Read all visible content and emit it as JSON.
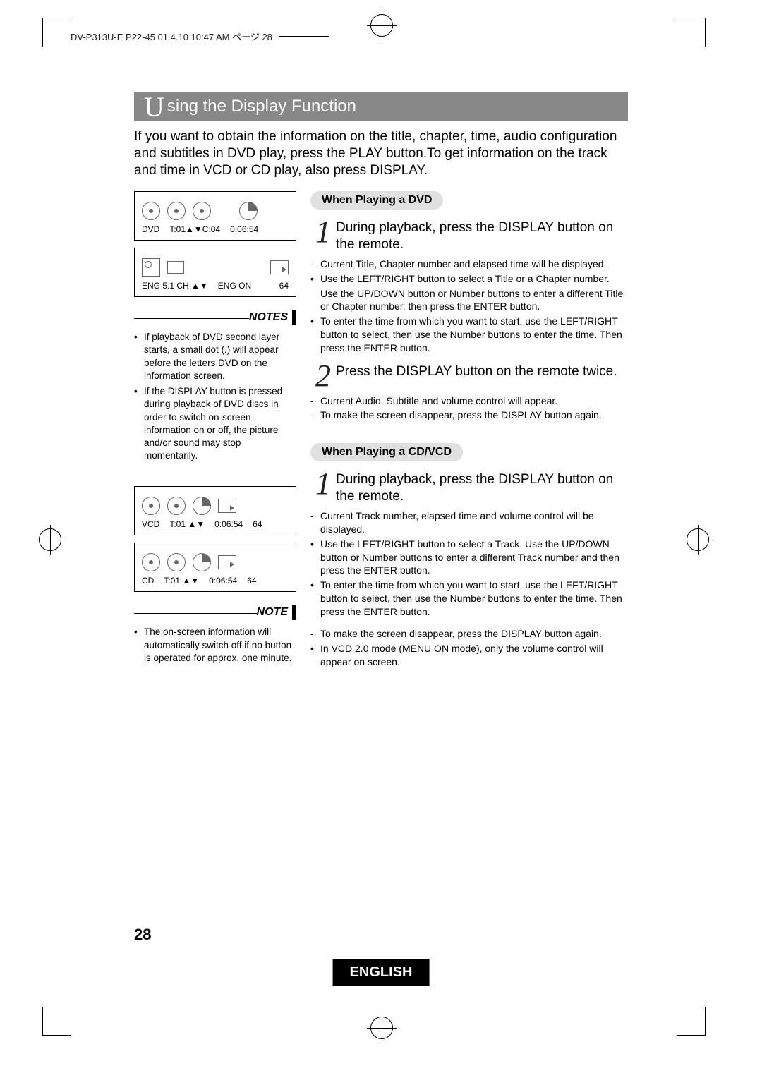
{
  "header": "DV-P313U-E  P22-45  01.4.10 10:47 AM  ページ 28",
  "title_cap": "U",
  "title_rest": "sing the Display Function",
  "intro": "If you want to obtain the information on the title, chapter, time, audio configuration and subtitles in DVD play, press the PLAY button.To get information on the track and time in VCD or CD play, also press DISPLAY.",
  "osd1": {
    "l1": "DVD",
    "l2": "T:01▲▼C:04",
    "l3": "0:06:54",
    "b1": "ENG 5.1 CH ▲▼",
    "b2": "ENG ON",
    "b3": "64"
  },
  "notes1_label": "NOTES",
  "notes1": [
    "If playback of DVD second layer starts, a small dot (.) will appear before the letters DVD on the information screen.",
    "If the DISPLAY button is pressed during playback of DVD discs in order to switch on-screen information on or off, the picture and/or sound may stop momentarily."
  ],
  "osd2": {
    "l1": "VCD",
    "l2": "T:01 ▲▼",
    "l3": "0:06:54",
    "l4": "64"
  },
  "osd3": {
    "l1": "CD",
    "l2": "T:01 ▲▼",
    "l3": "0:06:54",
    "l4": "64"
  },
  "notes2_label": "NOTE",
  "notes2": [
    "The on-screen information will automatically switch off if no button is operated for approx. one minute."
  ],
  "dvd_heading": "When Playing a DVD",
  "dvd_step1": "During playback, press the DISPLAY button on the remote.",
  "dvd_fine1": [
    {
      "d": "-",
      "t": "Current Title, Chapter number and elapsed time will be displayed."
    },
    {
      "d": "•",
      "t": "Use the LEFT/RIGHT button to select a Title or a Chapter number."
    },
    {
      "d": "",
      "t": "Use the UP/DOWN button or Number buttons to enter a different Title or Chapter number, then press the ENTER button."
    },
    {
      "d": "•",
      "t": "To enter the time from which you want to start, use the LEFT/RIGHT button to select, then use the Number buttons to enter the time. Then press the ENTER button."
    }
  ],
  "dvd_step2": "Press the DISPLAY button on the remote twice.",
  "dvd_fine2": [
    {
      "d": "-",
      "t": "Current Audio, Subtitle and volume control will appear."
    },
    {
      "d": "-",
      "t": "To make the screen disappear, press the DISPLAY button again."
    }
  ],
  "cd_heading": "When Playing a CD/VCD",
  "cd_step1": "During playback, press the DISPLAY button on the remote.",
  "cd_fine1": [
    {
      "d": "-",
      "t": "Current Track number, elapsed time and volume control will be displayed."
    },
    {
      "d": "•",
      "t": "Use the LEFT/RIGHT button to select a Track. Use the UP/DOWN button or Number buttons to enter a different Track number and then press the ENTER button."
    },
    {
      "d": "•",
      "t": "To enter the time from which you want to start, use the LEFT/RIGHT button to select, then use the Number buttons to enter the time. Then press the ENTER button."
    }
  ],
  "cd_fine2": [
    {
      "d": "-",
      "t": "To make the screen disappear, press the DISPLAY button again."
    },
    {
      "d": "•",
      "t": "In VCD 2.0 mode (MENU ON mode), only the volume control will appear on screen."
    }
  ],
  "page_number": "28",
  "language": "ENGLISH"
}
